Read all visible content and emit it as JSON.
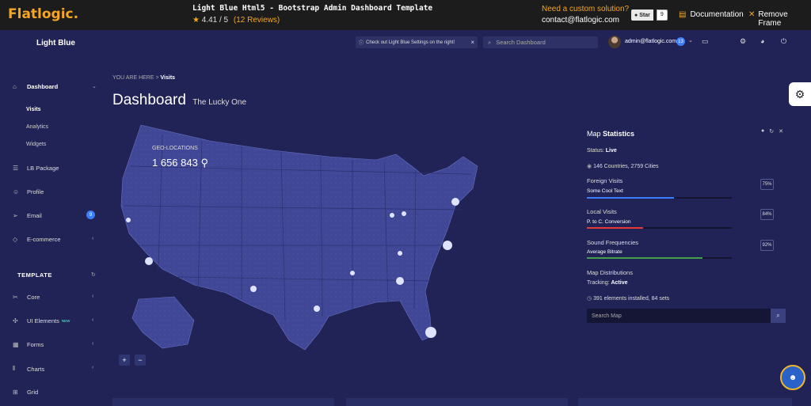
{
  "frame": {
    "logo": "Flatlogic.",
    "template_title": "Light Blue Html5 - Bootstrap Admin Dashboard Template",
    "rating": "4.41 / 5",
    "reviews": "(12 Reviews)",
    "custom_prompt": "Need a custom solution?",
    "contact": "contact@flatlogic.com",
    "github_star": "Star",
    "github_count": "9",
    "documentation": "Documentation",
    "remove_frame": "Remove Frame"
  },
  "topnav": {
    "brand": "Light Blue",
    "notice": "Check out Light Blue Settings on the right!",
    "search_placeholder": "Search Dashboard",
    "user_email": "admin@flatlogic.com",
    "notifications": "13"
  },
  "sidebar": {
    "dashboard": "Dashboard",
    "visits": "Visits",
    "analytics": "Analytics",
    "widgets": "Widgets",
    "lb_package": "LB Package",
    "profile": "Profile",
    "email": "Email",
    "email_badge": "9",
    "ecommerce": "E-commerce",
    "section_template": "TEMPLATE",
    "core": "Core",
    "ui_elements": "UI Elements",
    "ui_new_tag": "NEW",
    "forms": "Forms",
    "charts": "Charts",
    "grid": "Grid"
  },
  "breadcrumb": {
    "prefix": "YOU ARE HERE",
    "current": "Visits"
  },
  "page": {
    "title": "Dashboard",
    "subtitle": "The Lucky One"
  },
  "map": {
    "geo_label": "GEO-LOCATIONS",
    "geo_value": "1 656 843",
    "zoom_in": "+",
    "zoom_out": "−"
  },
  "stats": {
    "title_prefix": "Map",
    "title_bold": "Statistics",
    "status_label": "Status:",
    "status_value": "Live",
    "countries": "146 Countries, 2759 Cities",
    "foreign_label": "Foreign Visits",
    "foreign_sub": "Some Cool Text",
    "foreign_pct": "75%",
    "foreign_fill": 0.6,
    "local_label": "Local Visits",
    "local_sub": "P. to C. Conversion",
    "local_pct": "84%",
    "local_fill": 0.39,
    "sound_label": "Sound Frequencies",
    "sound_sub": "Average Bitrate",
    "sound_pct": "92%",
    "sound_fill": 0.8,
    "dist_label": "Map Distributions",
    "tracking_label": "Tracking:",
    "tracking_value": "Active",
    "installed": "391 elements installed, 84 sets",
    "search_placeholder": "Search Map"
  },
  "colors": {
    "accent": "#f5a623",
    "blue": "#3d7eff",
    "red": "#e53935",
    "green": "#43a047",
    "bg": "#212356"
  }
}
